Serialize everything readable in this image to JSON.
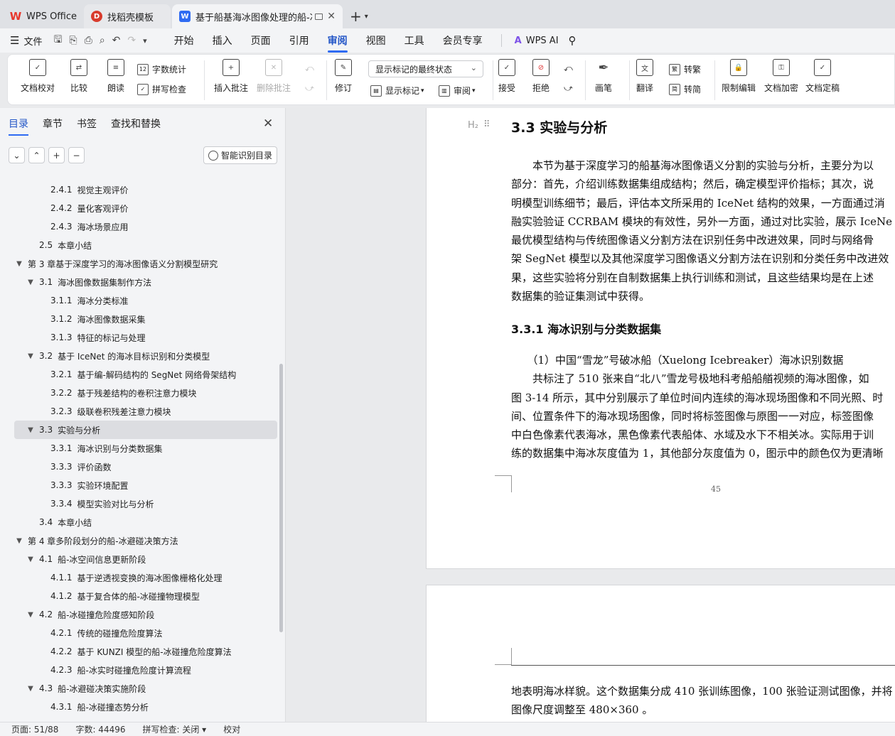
{
  "tabs": [
    {
      "label": "WPS Office",
      "icon": "wps-logo-icon"
    },
    {
      "label": "找稻壳模板",
      "icon": "docer-icon"
    },
    {
      "label": "基于船基海冰图像处理的船-冰",
      "icon": "word-doc-icon"
    }
  ],
  "menu": {
    "file": "文件",
    "items": [
      "开始",
      "插入",
      "页面",
      "引用",
      "审阅",
      "视图",
      "工具",
      "会员专享"
    ],
    "active": "审阅",
    "ai": "WPS AI"
  },
  "ribbon": {
    "doc_check": "文档校对",
    "compare": "比较",
    "read_aloud": "朗读",
    "word_count": "字数统计",
    "spell_check": "拼写检查",
    "insert_comment": "插入批注",
    "delete_comment": "删除批注",
    "revise": "修订",
    "markup_select": "显示标记的最终状态",
    "show_markup": "显示标记",
    "review": "审阅",
    "accept": "接受",
    "reject": "拒绝",
    "pen": "画笔",
    "translate": "翻译",
    "to_traditional": "转繁",
    "to_simplified": "转简",
    "restrict_edit": "限制编辑",
    "encrypt": "文档加密",
    "finalize": "文档定稿"
  },
  "nav": {
    "tabs": [
      "目录",
      "章节",
      "书签",
      "查找和替换"
    ],
    "smart_toc": "智能识别目录",
    "toc": [
      {
        "num": "2.4.1",
        "title": "视觉主观评价",
        "level": 3,
        "arrow": ""
      },
      {
        "num": "2.4.2",
        "title": "量化客观评价",
        "level": 3,
        "arrow": ""
      },
      {
        "num": "2.4.3",
        "title": "海冰场景应用",
        "level": 3,
        "arrow": ""
      },
      {
        "num": "2.5",
        "title": "本章小结",
        "level": 2,
        "arrow": ""
      },
      {
        "num": "",
        "title": "第 3 章基于深度学习的海冰图像语义分割模型研究",
        "level": 1,
        "arrow": "▼"
      },
      {
        "num": "3.1",
        "title": "海冰图像数据集制作方法",
        "level": 2,
        "arrow": "▼"
      },
      {
        "num": "3.1.1",
        "title": "海冰分类标准",
        "level": 3,
        "arrow": ""
      },
      {
        "num": "3.1.2",
        "title": "海冰图像数据采集",
        "level": 3,
        "arrow": ""
      },
      {
        "num": "3.1.3",
        "title": "特征的标记与处理",
        "level": 3,
        "arrow": ""
      },
      {
        "num": "3.2",
        "title": "基于 IceNet 的海冰目标识别和分类模型",
        "level": 2,
        "arrow": "▼"
      },
      {
        "num": "3.2.1",
        "title": "基于编-解码结构的 SegNet 网络骨架结构",
        "level": 3,
        "arrow": ""
      },
      {
        "num": "3.2.2",
        "title": "基于残差结构的卷积注意力模块",
        "level": 3,
        "arrow": ""
      },
      {
        "num": "3.2.3",
        "title": "级联卷积残差注意力模块",
        "level": 3,
        "arrow": ""
      },
      {
        "num": "3.3",
        "title": "实验与分析",
        "level": 2,
        "arrow": "▼",
        "selected": true
      },
      {
        "num": "3.3.1",
        "title": "海冰识别与分类数据集",
        "level": 3,
        "arrow": ""
      },
      {
        "num": "3.3.3",
        "title": "评价函数",
        "level": 3,
        "arrow": ""
      },
      {
        "num": "3.3.3",
        "title": "实验环境配置",
        "level": 3,
        "arrow": ""
      },
      {
        "num": "3.3.4",
        "title": "模型实验对比与分析",
        "level": 3,
        "arrow": ""
      },
      {
        "num": "3.4",
        "title": "本章小结",
        "level": 2,
        "arrow": ""
      },
      {
        "num": "",
        "title": "第 4 章多阶段划分的船-冰避碰决策方法",
        "level": 1,
        "arrow": "▼"
      },
      {
        "num": "4.1",
        "title": "船-冰空间信息更新阶段",
        "level": 2,
        "arrow": "▼"
      },
      {
        "num": "4.1.1",
        "title": "基于逆透视变换的海冰图像栅格化处理",
        "level": 3,
        "arrow": ""
      },
      {
        "num": "4.1.2",
        "title": "基于复合体的船-冰碰撞物理模型",
        "level": 3,
        "arrow": ""
      },
      {
        "num": "4.2",
        "title": "船-冰碰撞危险度感知阶段",
        "level": 2,
        "arrow": "▼"
      },
      {
        "num": "4.2.1",
        "title": "传统的碰撞危险度算法",
        "level": 3,
        "arrow": ""
      },
      {
        "num": "4.2.2",
        "title": "基于 KUNZI 模型的船-冰碰撞危险度算法",
        "level": 3,
        "arrow": ""
      },
      {
        "num": "4.2.3",
        "title": "船-冰实时碰撞危险度计算流程",
        "level": 3,
        "arrow": ""
      },
      {
        "num": "4.3",
        "title": "船-冰避碰决策实施阶段",
        "level": 2,
        "arrow": "▼"
      },
      {
        "num": "4.3.1",
        "title": "船-冰碰撞态势分析",
        "level": 3,
        "arrow": ""
      }
    ]
  },
  "doc": {
    "h2_mark": "H₂",
    "heading": "3.3  实验与分析",
    "para1": [
      "　　本节为基于深度学习的船基海冰图像语义分割的实验与分析，主要分为以",
      "部分：首先，介绍训练数据集组成结构；然后，确定模型评价指标；其次，说",
      "明模型训练细节；最后，评估本文所采用的 IceNet 结构的效果，一方面通过消",
      "融实验验证 CCRBAM 模块的有效性，另外一方面，通过对比实验，展示 IceNe",
      "最优模型结构与传统图像语义分割方法在识别任务中改进效果，同时与网络骨",
      "架 SegNet 模型以及其他深度学习图像语义分割方法在识别和分类任务中改进效",
      "果，这些实验将分别在自制数据集上执行训练和测试，且这些结果均是在上述",
      "数据集的验证集测试中获得。"
    ],
    "subheading": "3.3.1  海冰识别与分类数据集",
    "para2": [
      "　　（1）中国“雪龙”号破冰船（Xuelong Icebreaker）海冰识别数据",
      "　　共标注了 510 张来自“北八”雪龙号极地科考船船艏视频的海冰图像，如",
      "图 3-14 所示，其中分别展示了单位时间内连续的海冰现场图像和不同光照、时",
      "间、位置条件下的海冰现场图像，同时将标签图像与原图一一对应，标签图像",
      "中白色像素代表海冰，黑色像素代表船体、水域及水下不相关冰。实际用于训",
      "练的数据集中海冰灰度值为 1，其他部分灰度值为 0，图示中的颜色仅为更清晰"
    ],
    "page_number": "45",
    "para3": [
      "地表明海冰样貌。这个数据集分成 410 张训练图像，100 张验证测试图像，并将",
      "图像尺度调整至 480×360 。"
    ]
  },
  "status": {
    "page": "页面: 51/88",
    "words": "字数: 44496",
    "spell": "拼写检查: 关闭",
    "proof": "校对"
  }
}
